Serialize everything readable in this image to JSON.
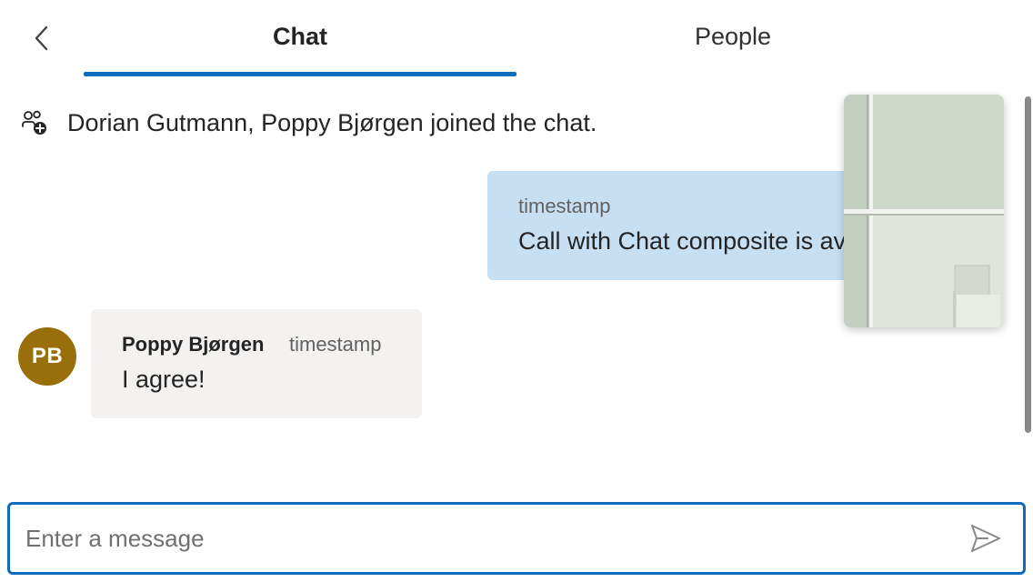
{
  "header": {
    "back_icon": "chevron-left-icon",
    "tabs": [
      {
        "label": "Chat",
        "selected": true
      },
      {
        "label": "People",
        "selected": false
      }
    ]
  },
  "messages": {
    "system": {
      "icon": "people-add-icon",
      "text": "Dorian Gutmann, Poppy Bjørgen joined the chat."
    },
    "outgoing": {
      "timestamp": "timestamp",
      "text": "Call with Chat composite is av"
    },
    "incoming": {
      "avatar_initials": "PB",
      "sender": "Poppy Bjørgen",
      "timestamp": "timestamp",
      "text": "I agree!"
    }
  },
  "composer": {
    "placeholder": "Enter a message",
    "value": "",
    "send_icon": "send-icon"
  },
  "colors": {
    "accent": "#0f6cbd",
    "outgoing_bubble": "#c7dff3",
    "incoming_bubble": "#f3f2f1",
    "avatar": "#986f0b"
  }
}
